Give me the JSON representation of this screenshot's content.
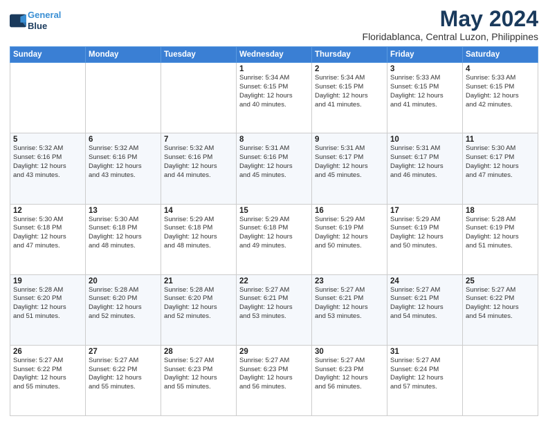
{
  "logo": {
    "line1": "General",
    "line2": "Blue"
  },
  "title": "May 2024",
  "subtitle": "Floridablanca, Central Luzon, Philippines",
  "weekdays": [
    "Sunday",
    "Monday",
    "Tuesday",
    "Wednesday",
    "Thursday",
    "Friday",
    "Saturday"
  ],
  "weeks": [
    [
      {
        "day": "",
        "info": ""
      },
      {
        "day": "",
        "info": ""
      },
      {
        "day": "",
        "info": ""
      },
      {
        "day": "1",
        "info": "Sunrise: 5:34 AM\nSunset: 6:15 PM\nDaylight: 12 hours\nand 40 minutes."
      },
      {
        "day": "2",
        "info": "Sunrise: 5:34 AM\nSunset: 6:15 PM\nDaylight: 12 hours\nand 41 minutes."
      },
      {
        "day": "3",
        "info": "Sunrise: 5:33 AM\nSunset: 6:15 PM\nDaylight: 12 hours\nand 41 minutes."
      },
      {
        "day": "4",
        "info": "Sunrise: 5:33 AM\nSunset: 6:15 PM\nDaylight: 12 hours\nand 42 minutes."
      }
    ],
    [
      {
        "day": "5",
        "info": "Sunrise: 5:32 AM\nSunset: 6:16 PM\nDaylight: 12 hours\nand 43 minutes."
      },
      {
        "day": "6",
        "info": "Sunrise: 5:32 AM\nSunset: 6:16 PM\nDaylight: 12 hours\nand 43 minutes."
      },
      {
        "day": "7",
        "info": "Sunrise: 5:32 AM\nSunset: 6:16 PM\nDaylight: 12 hours\nand 44 minutes."
      },
      {
        "day": "8",
        "info": "Sunrise: 5:31 AM\nSunset: 6:16 PM\nDaylight: 12 hours\nand 45 minutes."
      },
      {
        "day": "9",
        "info": "Sunrise: 5:31 AM\nSunset: 6:17 PM\nDaylight: 12 hours\nand 45 minutes."
      },
      {
        "day": "10",
        "info": "Sunrise: 5:31 AM\nSunset: 6:17 PM\nDaylight: 12 hours\nand 46 minutes."
      },
      {
        "day": "11",
        "info": "Sunrise: 5:30 AM\nSunset: 6:17 PM\nDaylight: 12 hours\nand 47 minutes."
      }
    ],
    [
      {
        "day": "12",
        "info": "Sunrise: 5:30 AM\nSunset: 6:18 PM\nDaylight: 12 hours\nand 47 minutes."
      },
      {
        "day": "13",
        "info": "Sunrise: 5:30 AM\nSunset: 6:18 PM\nDaylight: 12 hours\nand 48 minutes."
      },
      {
        "day": "14",
        "info": "Sunrise: 5:29 AM\nSunset: 6:18 PM\nDaylight: 12 hours\nand 48 minutes."
      },
      {
        "day": "15",
        "info": "Sunrise: 5:29 AM\nSunset: 6:18 PM\nDaylight: 12 hours\nand 49 minutes."
      },
      {
        "day": "16",
        "info": "Sunrise: 5:29 AM\nSunset: 6:19 PM\nDaylight: 12 hours\nand 50 minutes."
      },
      {
        "day": "17",
        "info": "Sunrise: 5:29 AM\nSunset: 6:19 PM\nDaylight: 12 hours\nand 50 minutes."
      },
      {
        "day": "18",
        "info": "Sunrise: 5:28 AM\nSunset: 6:19 PM\nDaylight: 12 hours\nand 51 minutes."
      }
    ],
    [
      {
        "day": "19",
        "info": "Sunrise: 5:28 AM\nSunset: 6:20 PM\nDaylight: 12 hours\nand 51 minutes."
      },
      {
        "day": "20",
        "info": "Sunrise: 5:28 AM\nSunset: 6:20 PM\nDaylight: 12 hours\nand 52 minutes."
      },
      {
        "day": "21",
        "info": "Sunrise: 5:28 AM\nSunset: 6:20 PM\nDaylight: 12 hours\nand 52 minutes."
      },
      {
        "day": "22",
        "info": "Sunrise: 5:27 AM\nSunset: 6:21 PM\nDaylight: 12 hours\nand 53 minutes."
      },
      {
        "day": "23",
        "info": "Sunrise: 5:27 AM\nSunset: 6:21 PM\nDaylight: 12 hours\nand 53 minutes."
      },
      {
        "day": "24",
        "info": "Sunrise: 5:27 AM\nSunset: 6:21 PM\nDaylight: 12 hours\nand 54 minutes."
      },
      {
        "day": "25",
        "info": "Sunrise: 5:27 AM\nSunset: 6:22 PM\nDaylight: 12 hours\nand 54 minutes."
      }
    ],
    [
      {
        "day": "26",
        "info": "Sunrise: 5:27 AM\nSunset: 6:22 PM\nDaylight: 12 hours\nand 55 minutes."
      },
      {
        "day": "27",
        "info": "Sunrise: 5:27 AM\nSunset: 6:22 PM\nDaylight: 12 hours\nand 55 minutes."
      },
      {
        "day": "28",
        "info": "Sunrise: 5:27 AM\nSunset: 6:23 PM\nDaylight: 12 hours\nand 55 minutes."
      },
      {
        "day": "29",
        "info": "Sunrise: 5:27 AM\nSunset: 6:23 PM\nDaylight: 12 hours\nand 56 minutes."
      },
      {
        "day": "30",
        "info": "Sunrise: 5:27 AM\nSunset: 6:23 PM\nDaylight: 12 hours\nand 56 minutes."
      },
      {
        "day": "31",
        "info": "Sunrise: 5:27 AM\nSunset: 6:24 PM\nDaylight: 12 hours\nand 57 minutes."
      },
      {
        "day": "",
        "info": ""
      }
    ]
  ]
}
